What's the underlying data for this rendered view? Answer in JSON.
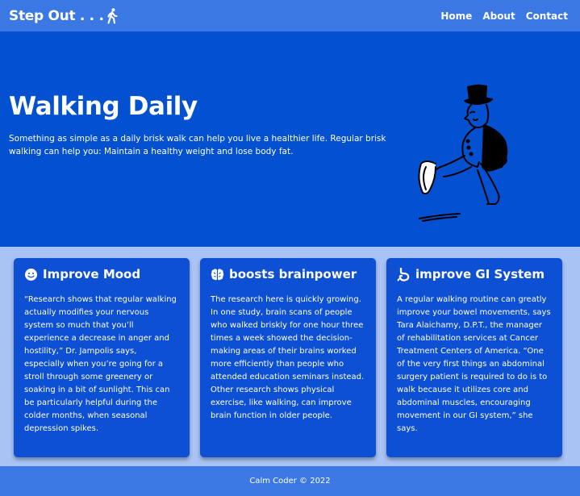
{
  "nav": {
    "brand": "Step Out . . .",
    "brand_icon": "walking-person-icon",
    "links": [
      "Home",
      "About",
      "Contact"
    ]
  },
  "hero": {
    "title": "Walking Daily",
    "text": "Something as simple as a daily brisk walk can help you live a healthier life. Regular brisk walking can help you: Maintain a healthy weight and lose body fat.",
    "illustration": "walking-man-top-hat-illustration"
  },
  "cards": [
    {
      "icon": "smiley-icon",
      "title": "Improve Mood",
      "text": "“Research shows that regular walking actually modifies your nervous system so much that you’ll experience a decrease in anger and hostility,” Dr. Jampolis says, especially when you’re going for a stroll through some greenery or soaking in a bit of sunlight. This can be particularly helpful during the colder months, when seasonal depression spikes."
    },
    {
      "icon": "brain-icon",
      "title": "boosts brainpower",
      "text": "The research here is quickly growing. In one study, brain scans of people who walked briskly for one hour three times a week showed the decision-making areas of their brains worked more efficiently than people who attended education seminars instead. Other research shows physical exercise, like walking, can improve brain function in older people."
    },
    {
      "icon": "stomach-icon",
      "title": "improve GI System",
      "text": "A regular walking routine can greatly improve your bowel movements, says Tara Alaichamy, D.P.T., the manager of rehabilitation services at Cancer Treatment Centers of America. “One of the very first things an abdominal surgery patient is required to do is to walk because it utilizes core and abdominal muscles, encouraging movement in our GI system,” she says."
    }
  ],
  "footer": {
    "text": "Calm Coder © 2022"
  },
  "colors": {
    "navbar": "#3b78e4",
    "hero": "#0350d0",
    "card": "#0d50d3",
    "page": "#a9c3f5"
  }
}
